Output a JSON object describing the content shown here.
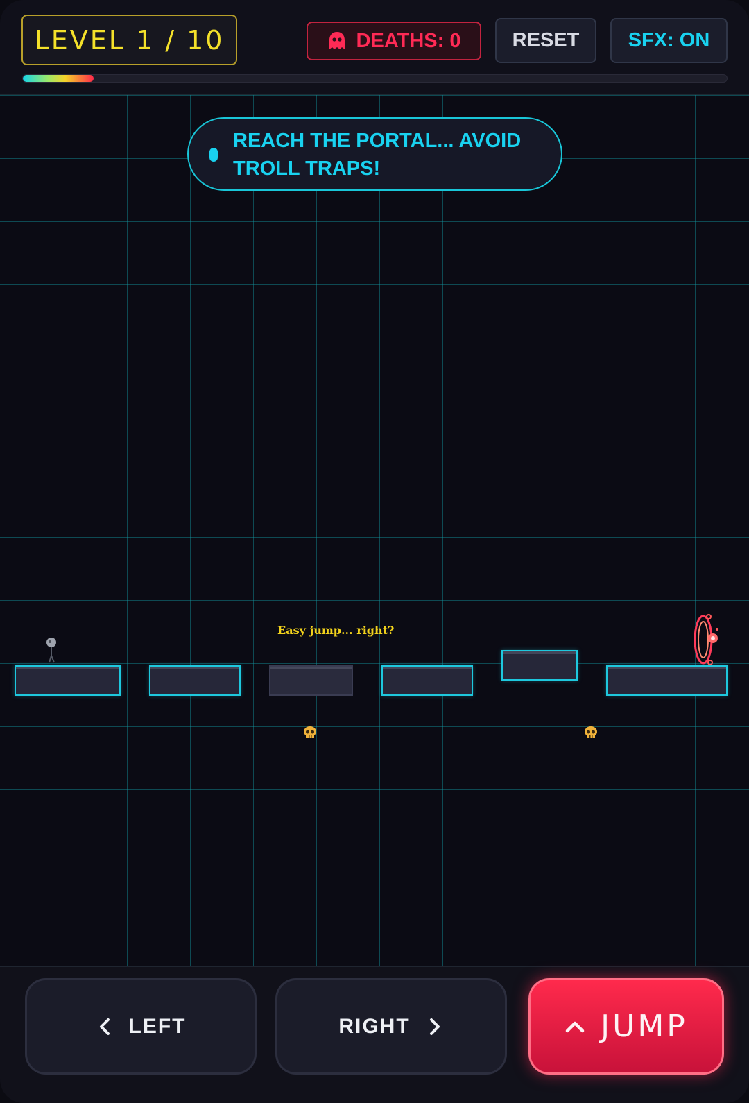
{
  "header": {
    "level_label": "LEVEL 1 / 10",
    "deaths_label": "DEATHS: 0",
    "reset_label": "RESET",
    "sfx_label": "SFX: ON",
    "progress": 0.1,
    "icons": {
      "deaths": "ghost-icon"
    }
  },
  "playfield": {
    "hint_text": "REACH THE PORTAL... AVOID TROLL TRAPS!",
    "troll_text": "Easy jump... right?"
  },
  "controls": {
    "left_label": "LEFT",
    "right_label": "RIGHT",
    "jump_label": "JUMP",
    "icons": {
      "left": "chevron-left-icon",
      "right": "chevron-right-icon",
      "jump": "chevron-up-icon"
    }
  },
  "colors": {
    "accent_cyan": "#19d2f0",
    "level_yellow": "#f4e12a",
    "danger_red": "#ff2a55",
    "background": "#0b0b14"
  }
}
